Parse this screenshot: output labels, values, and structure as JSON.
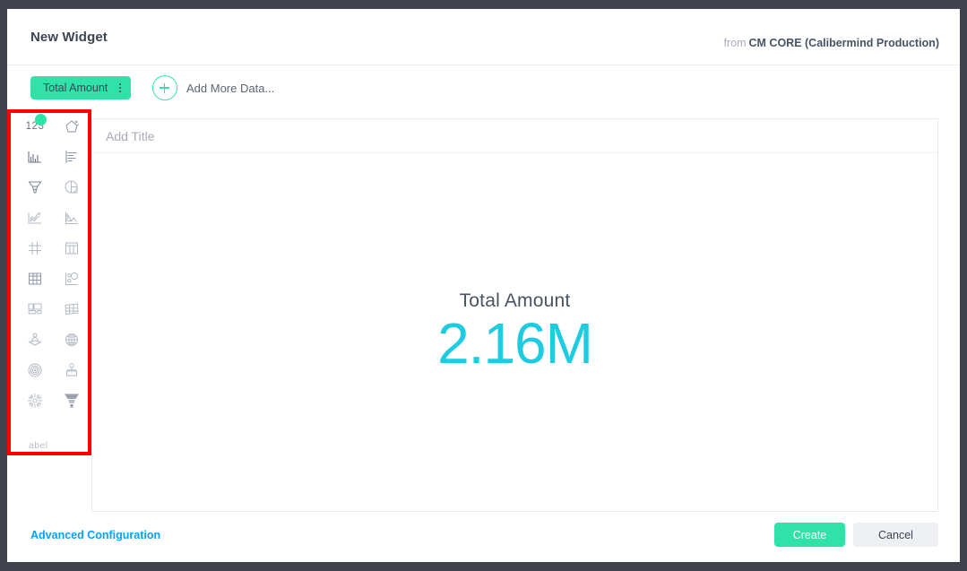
{
  "header": {
    "widget_title": "New Widget",
    "source_prefix": "from",
    "source_name": "CM CORE (Calibermind Production)"
  },
  "data_chips": {
    "chips": [
      {
        "label": "Total Amount",
        "menu_icon": "vertical-dots-icon"
      }
    ],
    "add_icon": "plus-icon",
    "add_more_label": "Add More Data..."
  },
  "palette": {
    "truncated_label": "abel",
    "selected_index": 0,
    "icons": [
      {
        "name": "number-metric-icon",
        "glyph": "123",
        "selected": true
      },
      {
        "name": "magic-shape-icon",
        "glyph": "star-wand"
      },
      {
        "name": "bar-chart-icon",
        "glyph": "vertical-bars"
      },
      {
        "name": "horizontal-bar-chart-icon",
        "glyph": "horizontal-bars"
      },
      {
        "name": "funnel-chart-icon",
        "glyph": "funnel"
      },
      {
        "name": "pie-chart-icon",
        "glyph": "pie"
      },
      {
        "name": "line-chart-icon",
        "glyph": "trend-line"
      },
      {
        "name": "area-chart-icon",
        "glyph": "area"
      },
      {
        "name": "grid-icon",
        "glyph": "grid-lines"
      },
      {
        "name": "table-icon",
        "glyph": "table-columns"
      },
      {
        "name": "data-table-icon",
        "glyph": "table-filled"
      },
      {
        "name": "scatter-plot-icon",
        "glyph": "bubbles"
      },
      {
        "name": "dashboard-layout-icon",
        "glyph": "panels"
      },
      {
        "name": "matrix-icon",
        "glyph": "matrix-grid"
      },
      {
        "name": "journey-map-icon",
        "glyph": "person-map"
      },
      {
        "name": "globe-icon",
        "glyph": "globe"
      },
      {
        "name": "radar-target-icon",
        "glyph": "concentric-circles"
      },
      {
        "name": "org-node-icon",
        "glyph": "node-box"
      },
      {
        "name": "sunburst-icon",
        "glyph": "burst"
      },
      {
        "name": "solid-funnel-icon",
        "glyph": "funnel-filled"
      }
    ]
  },
  "preview": {
    "title_placeholder": "Add Title",
    "title_value": "",
    "metric_label": "Total Amount",
    "metric_value": "2.16M"
  },
  "footer": {
    "advanced_configuration": "Advanced Configuration",
    "create_label": "Create",
    "cancel_label": "Cancel"
  },
  "colors": {
    "accent_green": "#2fe3a8",
    "metric_cyan": "#1ecbe1",
    "link_blue": "#00a3ff",
    "annotation_red": "#ff0000",
    "backdrop": "#40434e"
  }
}
